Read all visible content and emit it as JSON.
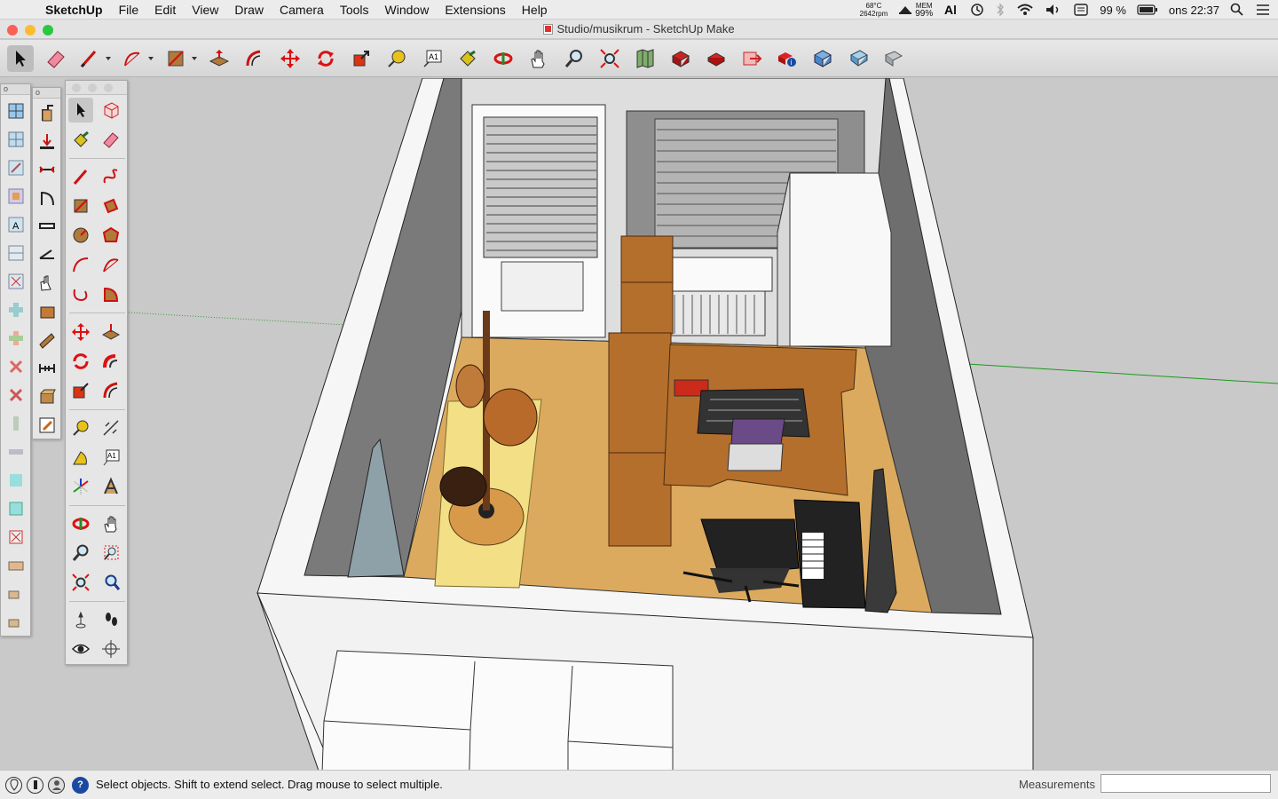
{
  "menubar": {
    "app_name": "SketchUp",
    "items": [
      "File",
      "Edit",
      "View",
      "Draw",
      "Camera",
      "Tools",
      "Window",
      "Extensions",
      "Help"
    ],
    "status": {
      "temp": "68°C",
      "rpm": "2642rpm",
      "mem_label": "MEM",
      "mem_value": "99%",
      "battery": "99 %",
      "clock": "ons 22:37"
    }
  },
  "window": {
    "title": "Studio/musikrum - SketchUp Make",
    "traffic_colors": [
      "#fc5f57",
      "#fdbc2e",
      "#28c840"
    ]
  },
  "toolbar": {
    "tools": [
      {
        "name": "select-tool",
        "icon": "arrow-icon"
      },
      {
        "name": "eraser-tool",
        "icon": "eraser-icon"
      },
      {
        "name": "line-tool",
        "icon": "pencil-icon"
      },
      {
        "name": "arc-tool",
        "icon": "arc-icon"
      },
      {
        "name": "rectangle-tool",
        "icon": "rectangle-icon"
      },
      {
        "name": "push-pull-tool",
        "icon": "push-pull-icon"
      },
      {
        "name": "offset-tool",
        "icon": "offset-icon"
      },
      {
        "name": "move-tool",
        "icon": "move-icon"
      },
      {
        "name": "rotate-tool",
        "icon": "rotate-icon"
      },
      {
        "name": "scale-tool",
        "icon": "scale-icon"
      },
      {
        "name": "tape-measure-tool",
        "icon": "tape-measure-icon"
      },
      {
        "name": "text-tool",
        "icon": "text-icon"
      },
      {
        "name": "paint-bucket-tool",
        "icon": "paint-bucket-icon"
      },
      {
        "name": "orbit-tool",
        "icon": "orbit-icon"
      },
      {
        "name": "pan-tool",
        "icon": "hand-icon"
      },
      {
        "name": "zoom-tool",
        "icon": "magnifier-icon"
      },
      {
        "name": "zoom-extents-tool",
        "icon": "zoom-extents-icon"
      },
      {
        "name": "add-location-tool",
        "icon": "map-icon"
      },
      {
        "name": "3d-warehouse-tool",
        "icon": "warehouse-icon"
      },
      {
        "name": "share-model-tool",
        "icon": "share-icon"
      },
      {
        "name": "extension-warehouse-tool",
        "icon": "extension-icon"
      },
      {
        "name": "layout-tool",
        "icon": "layout-icon"
      },
      {
        "name": "model-info-tool",
        "icon": "info-icon"
      },
      {
        "name": "components-tool",
        "icon": "components-icon"
      },
      {
        "name": "styles-tool",
        "icon": "styles-icon"
      },
      {
        "name": "layers-tool",
        "icon": "layers-icon"
      }
    ]
  },
  "statusbar": {
    "hint": "Select objects. Shift to extend select. Drag mouse to select multiple.",
    "measurements_label": "Measurements",
    "measurements_value": ""
  }
}
